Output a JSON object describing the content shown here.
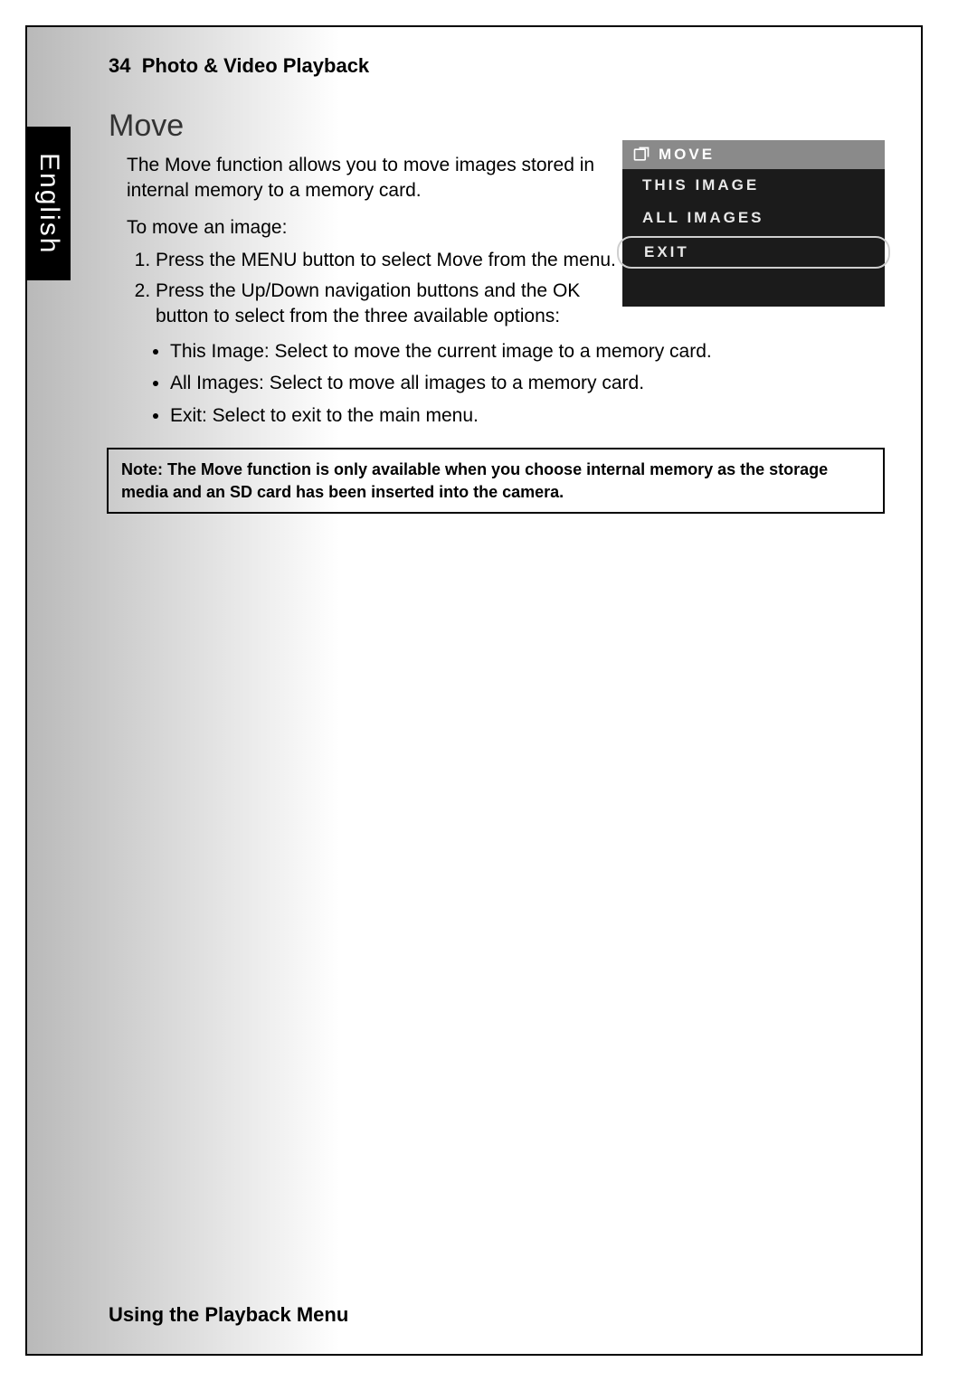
{
  "page": {
    "language_tab": "English",
    "header_number": "34",
    "header_title": "Photo & Video Playback",
    "section_title": "Move",
    "intro": "The Move function allows you to move images stored in internal memory to a memory card.",
    "lead": "To move an image:",
    "steps": [
      "Press the MENU button to select Move from the menu.",
      "Press the Up/Down navigation buttons and the OK button to select from the three available options:"
    ],
    "options": [
      "This Image: Select to move the current image to a memory card.",
      "All Images: Select to move all images to a memory card.",
      "Exit: Select to exit to the main menu."
    ],
    "note": "Note: The Move function is only available when you choose internal memory as the storage media and an SD card has been inserted into the camera.",
    "footer": "Using the Playback Menu"
  },
  "device_menu": {
    "title": "MOVE",
    "items": [
      "THIS IMAGE",
      "ALL IMAGES",
      "EXIT"
    ],
    "selected_index": 2
  }
}
